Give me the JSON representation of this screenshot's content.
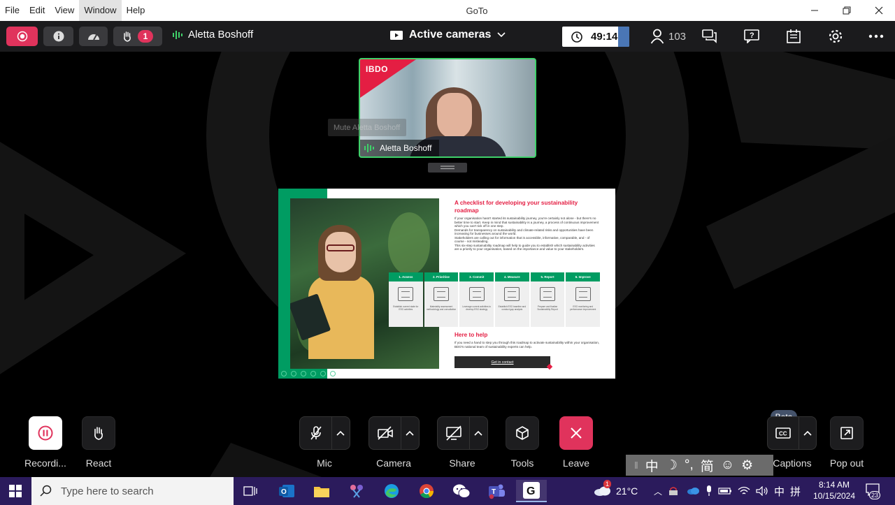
{
  "window": {
    "title": "GoTo",
    "menu": [
      "File",
      "Edit",
      "View",
      "Window",
      "Help"
    ],
    "active_menu": "Window"
  },
  "toolbar": {
    "speaker_name": "Aletta Boshoff",
    "raised_hands_count": "1",
    "layout_label": "Active cameras",
    "timer": "49:14",
    "attendee_count": "103"
  },
  "video": {
    "participant_name": "Aletta Boshoff",
    "brand": "IBDO",
    "tooltip": "Mute Aletta Boshoff"
  },
  "slide": {
    "heading": "A checklist for developing your sustainability roadmap",
    "paragraphs": [
      "If your organisation hasn't started its sustainability journey, you're certainly not alone - but there's no better time to start. Keep in mind that sustainability is a journey, a process of continuous improvement which you can't tick off in one step.",
      "Demands for transparency on sustainability and climate-related risks and opportunities have been increasing for businesses around the world.",
      "Stakeholders are calling out for information that is accessible, informative, comparable, and - of course - not misleading.",
      "This six-step sustainability roadmap will help to guide you to establish which sustainability activities are a priority to your organisation, based on the importance and value to your stakeholders."
    ],
    "steps": [
      {
        "title": "1. Assess",
        "text": "Establish current state for ESG activities"
      },
      {
        "title": "2. Prioritise",
        "text": "Materiality assessment methodology and consultation"
      },
      {
        "title": "3. Commit",
        "text": "Leverage current activities to develop ESG strategy"
      },
      {
        "title": "4. Measure",
        "text": "Establish ESG baseline and conduct gap analysis"
      },
      {
        "title": "5. Report",
        "text": "Prepare and finalise Sustainability Report"
      },
      {
        "title": "6. Improve",
        "text": "ESG monitoring and performance improvement"
      }
    ],
    "help_heading": "Here to help",
    "help_text": "If you need a hand to step you through this roadmap to activate sustainability within your organisation, BDO's national team of sustainability experts can help.",
    "cta_label": "Get in contact"
  },
  "controls": {
    "recording": "Recordi...",
    "react": "React",
    "mic": "Mic",
    "camera": "Camera",
    "share": "Share",
    "tools": "Tools",
    "leave": "Leave",
    "captions": "Captions",
    "captions_badge": "Beta",
    "pop_out": "Pop out"
  },
  "ime_bar": {
    "mode": "中",
    "punct": "°,",
    "script": "简"
  },
  "taskbar": {
    "search_placeholder": "Type here to search",
    "weather": "21°C",
    "weather_alert": "1",
    "input_lang": "中",
    "input_mode": "拼",
    "time": "8:14 AM",
    "date": "10/15/2024",
    "notifications": "23"
  },
  "colors": {
    "accent_red": "#e0335c",
    "speaking_green": "#3fd16a",
    "bdo_red": "#e41e43",
    "slide_green": "#009c62",
    "taskbar": "#2b1b5c"
  }
}
